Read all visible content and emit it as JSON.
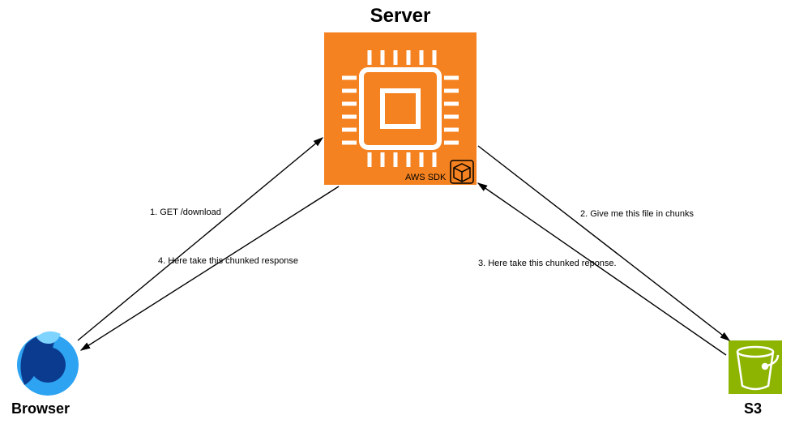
{
  "title": "Server",
  "nodes": {
    "server": {
      "label": "Server",
      "sdk_label": "AWS SDK"
    },
    "browser": {
      "label": "Browser"
    },
    "s3": {
      "label": "S3"
    }
  },
  "arrows": {
    "step1": "1. GET /download",
    "step2": "2. Give me this file in chunks",
    "step3": "3. Here take this chunked reponse.",
    "step4": "4. Here take this chunked response"
  },
  "colors": {
    "server_bg": "#F58220",
    "server_fg": "#FFFFFF",
    "s3_bg": "#8CB400",
    "s3_fg": "#FFFFFF",
    "browser_blue_dark": "#0A3B8F",
    "browser_blue_light": "#2EA3F2",
    "arrow": "#000000"
  }
}
